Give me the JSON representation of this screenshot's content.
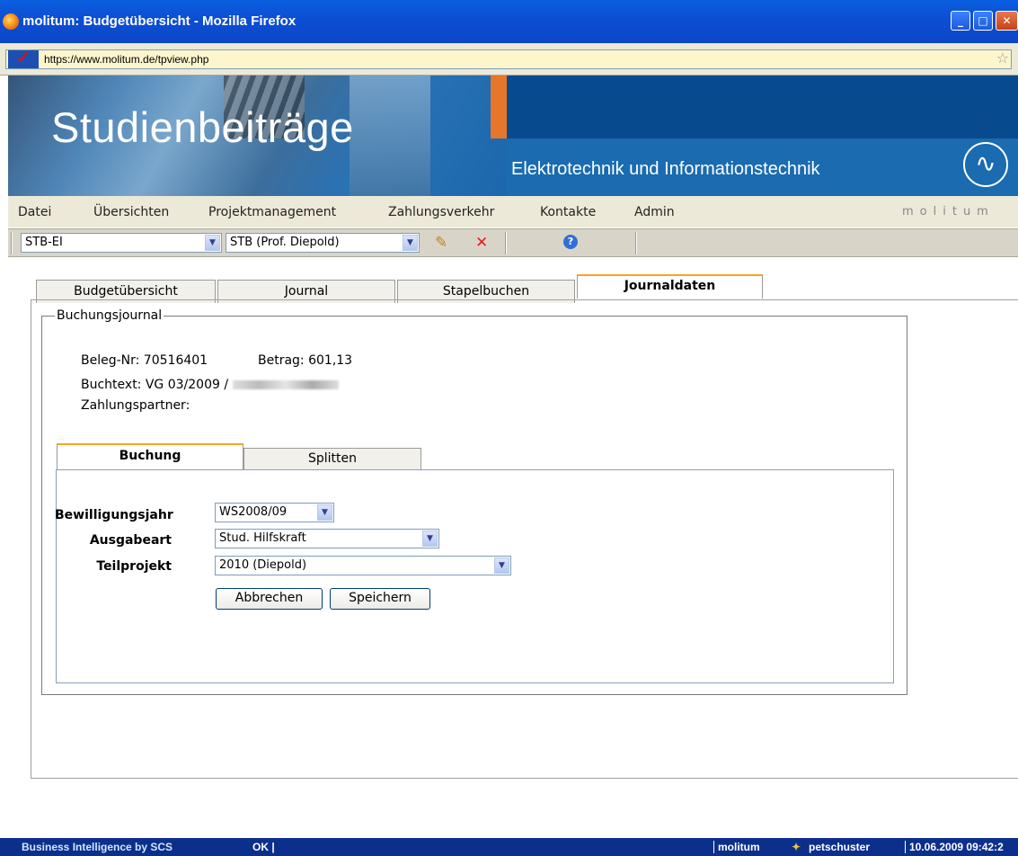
{
  "window": {
    "title": "molitum: Budgetübersicht - Mozilla Firefox",
    "url": "https://www.molitum.de/tpview.php"
  },
  "banner": {
    "title": "Studienbeiträge",
    "subtitle": "Elektrotechnik und Informationstechnik"
  },
  "menu": {
    "items": [
      "Datei",
      "Übersichten",
      "Projektmanagement",
      "Zahlungsverkehr",
      "Kontakte",
      "Admin"
    ],
    "brand": "molitum"
  },
  "toolbar": {
    "select1": "STB-EI",
    "select2": "STB (Prof. Diepold)"
  },
  "tabs": [
    "Budgetübersicht",
    "Journal",
    "Stapelbuchen",
    "Journaldaten"
  ],
  "journal": {
    "legend": "Buchungsjournal",
    "beleg": "Beleg-Nr: 70516401",
    "betrag": "Betrag: 601,13",
    "buchtext": "Buchtext: VG 03/2009 /",
    "partner": "Zahlungspartner:"
  },
  "subtabs": [
    "Buchung",
    "Splitten"
  ],
  "form": {
    "bewilligungsjahr_label": "Bewilligungsjahr",
    "bewilligungsjahr_value": "WS2008/09",
    "ausgabeart_label": "Ausgabeart",
    "ausgabeart_value": "Stud. Hilfskraft",
    "teilprojekt_label": "Teilprojekt",
    "teilprojekt_value": "2010 (Diepold)",
    "cancel": "Abbrechen",
    "save": "Speichern"
  },
  "status": {
    "left": "Business Intelligence by SCS",
    "ok": "OK |",
    "app": "molitum",
    "user": "petschuster",
    "datetime": "10.06.2009 09:42:2"
  }
}
